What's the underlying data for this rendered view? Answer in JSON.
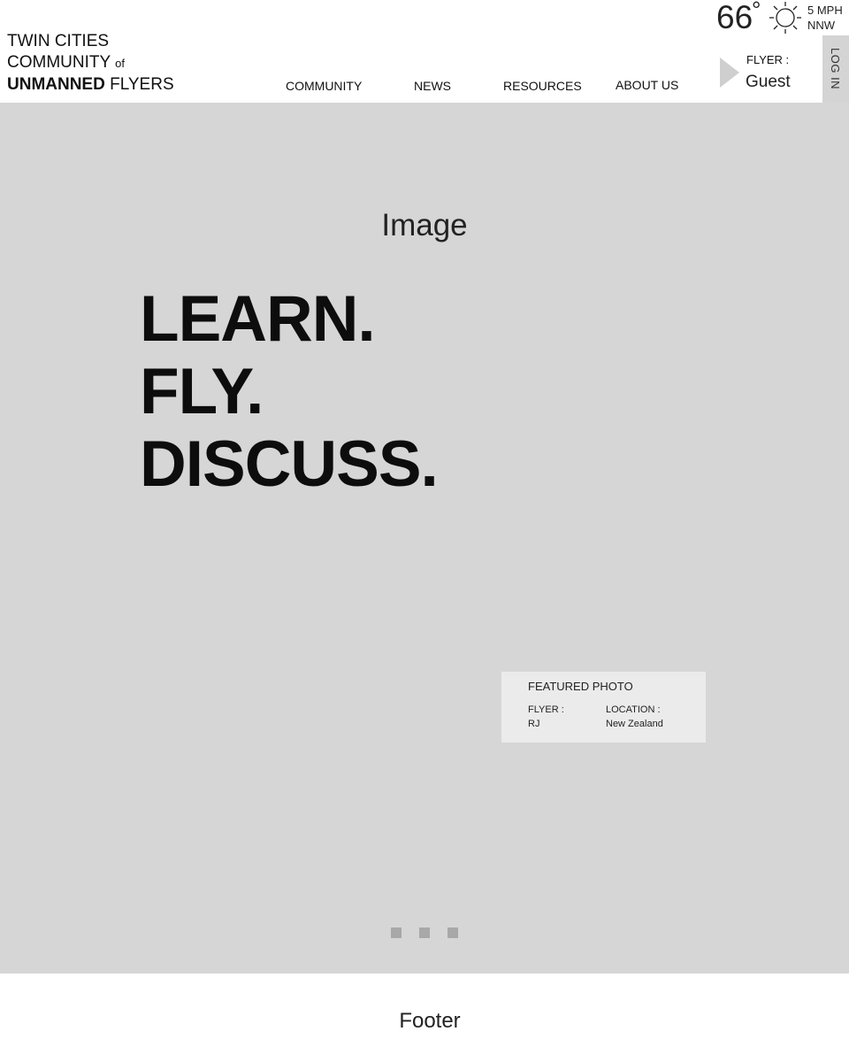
{
  "logo": {
    "line1": "TWIN CITIES",
    "line2": "COMMUNITY",
    "line2_small": "of",
    "line3_bold": "UNMANNED",
    "line3_rest": "FLYERS"
  },
  "nav": {
    "items": [
      {
        "label": "COMMUNITY"
      },
      {
        "label": "NEWS"
      },
      {
        "label": "RESOURCES"
      },
      {
        "label": "ABOUT US"
      }
    ]
  },
  "weather": {
    "temperature": "66",
    "degree_symbol": "°",
    "icon": "sun-icon",
    "wind_speed": "5 MPH",
    "wind_direction": "NNW"
  },
  "flyer": {
    "label": "FLYER :",
    "name": "Guest"
  },
  "login": {
    "label": "LOG IN"
  },
  "hero": {
    "placeholder": "Image",
    "tagline": [
      "LEARN.",
      "FLY.",
      "DISCUSS."
    ],
    "featured": {
      "title": "FEATURED PHOTO",
      "flyer_label": "FLYER :",
      "flyer_value": "RJ",
      "location_label": "LOCATION :",
      "location_value": "New Zealand"
    },
    "carousel_dots": 3
  },
  "footer": {
    "label": "Footer"
  },
  "colors": {
    "hero_bg": "#d6d6d6",
    "featured_bg": "#ebebeb",
    "login_tab_bg": "#d4d4d4",
    "dot": "#a8a8a8"
  }
}
